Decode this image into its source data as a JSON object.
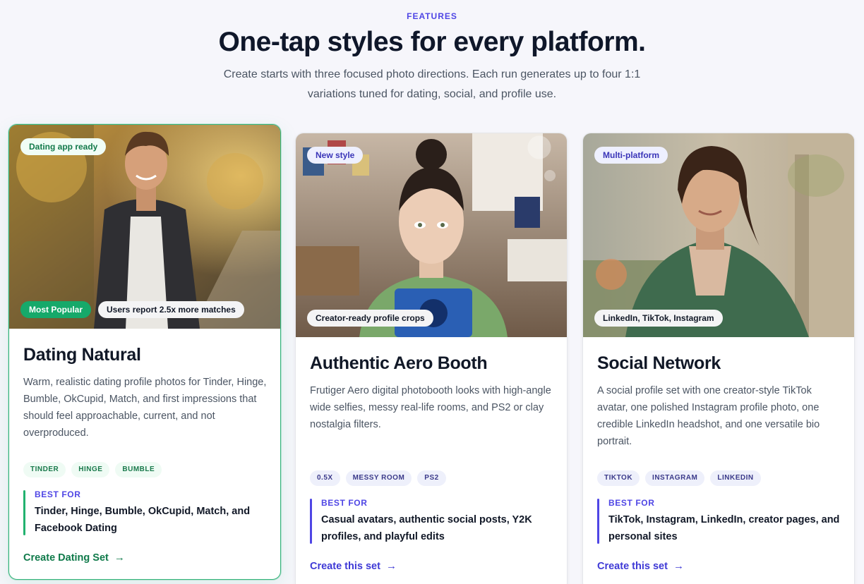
{
  "section": {
    "eyebrow": "FEATURES",
    "headline": "One-tap styles for every platform.",
    "subhead": "Create starts with three focused photo directions. Each run generates up to four 1:1 variations tuned for dating, social, and profile use."
  },
  "cards": [
    {
      "top_badge": "Dating app ready",
      "bottom_badges": [
        "Most Popular",
        "Users report 2.5x more matches"
      ],
      "title": "Dating Natural",
      "description": "Warm, realistic dating profile photos for Tinder, Hinge, Bumble, OkCupid, Match, and first impressions that should feel approachable, current, and not overproduced.",
      "chips": [
        "TINDER",
        "HINGE",
        "BUMBLE"
      ],
      "best_for_label": "BEST FOR",
      "best_for": "Tinder, Hinge, Bumble, OkCupid, Match, and Facebook Dating",
      "cta": "Create Dating Set",
      "cta_icon": "arrow-right-icon",
      "accent": "#16a96a"
    },
    {
      "top_badge": "New style",
      "bottom_badges": [
        "Creator-ready profile crops"
      ],
      "title": "Authentic Aero Booth",
      "description": "Frutiger Aero digital photobooth looks with high-angle wide selfies, messy real-life rooms, and PS2 or clay nostalgia filters.",
      "chips": [
        "0.5X",
        "MESSY ROOM",
        "PS2"
      ],
      "best_for_label": "BEST FOR",
      "best_for": "Casual avatars, authentic social posts, Y2K profiles, and playful edits",
      "cta": "Create this set",
      "cta_icon": "arrow-right-icon",
      "accent": "#4f46e5"
    },
    {
      "top_badge": "Multi-platform",
      "bottom_badges": [
        "LinkedIn, TikTok, Instagram"
      ],
      "title": "Social Network",
      "description": "A social profile set with one creator-style TikTok avatar, one polished Instagram profile photo, one credible LinkedIn headshot, and one versatile bio portrait.",
      "chips": [
        "TIKTOK",
        "INSTAGRAM",
        "LINKEDIN"
      ],
      "best_for_label": "BEST FOR",
      "best_for": "TikTok, Instagram, LinkedIn, creator pages, and personal sites",
      "cta": "Create this set",
      "cta_icon": "arrow-right-icon",
      "accent": "#4f46e5"
    }
  ]
}
